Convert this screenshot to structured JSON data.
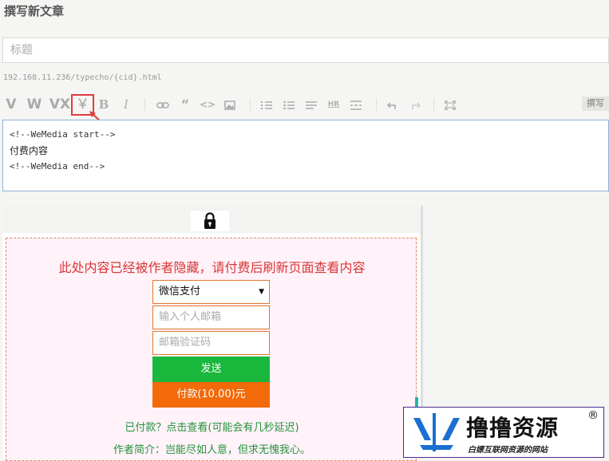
{
  "header": {
    "title": "撰写新文章"
  },
  "title_field": {
    "placeholder": "标题"
  },
  "permalink": "192.168.11.236/typecho/{cid}.html",
  "toolbar": {
    "buttons": [
      {
        "label": "V",
        "icon": "wemedia-v-icon"
      },
      {
        "label": "W",
        "icon": "wemedia-w-icon"
      },
      {
        "label": "VX",
        "icon": "wemedia-vx-icon"
      },
      {
        "label": "￥",
        "icon": "paid-content-icon"
      },
      {
        "label": "B",
        "icon": "bold-icon"
      },
      {
        "label": "I",
        "icon": "italic-icon"
      }
    ],
    "write_tab": "撰写"
  },
  "editor": {
    "lines": [
      "<!--WeMedia start-->",
      "付费内容",
      "<!--WeMedia end-->"
    ]
  },
  "paywall": {
    "message": "此处内容已经被作者隐藏，请付费后刷新页面查看内容",
    "payment_method": "微信支付",
    "email_placeholder": "输入个人邮箱",
    "code_placeholder": "邮箱验证码",
    "send_label": "发送",
    "pay_label": "付款(10.00)元",
    "paid_link": "已付款？点击查看(可能会有几秒延迟)",
    "author_intro": "作者简介：岂能尽如人意，但求无愧我心。"
  },
  "watermark": {
    "name": "撸撸资源",
    "tagline": "白嫖互联网资源的网站",
    "reg": "®"
  },
  "colors": {
    "paywall_text": "#d93636",
    "send_button": "#19b73c",
    "pay_button": "#f26a0a",
    "green_text": "#23923a",
    "highlight_border": "#e23b3b"
  }
}
